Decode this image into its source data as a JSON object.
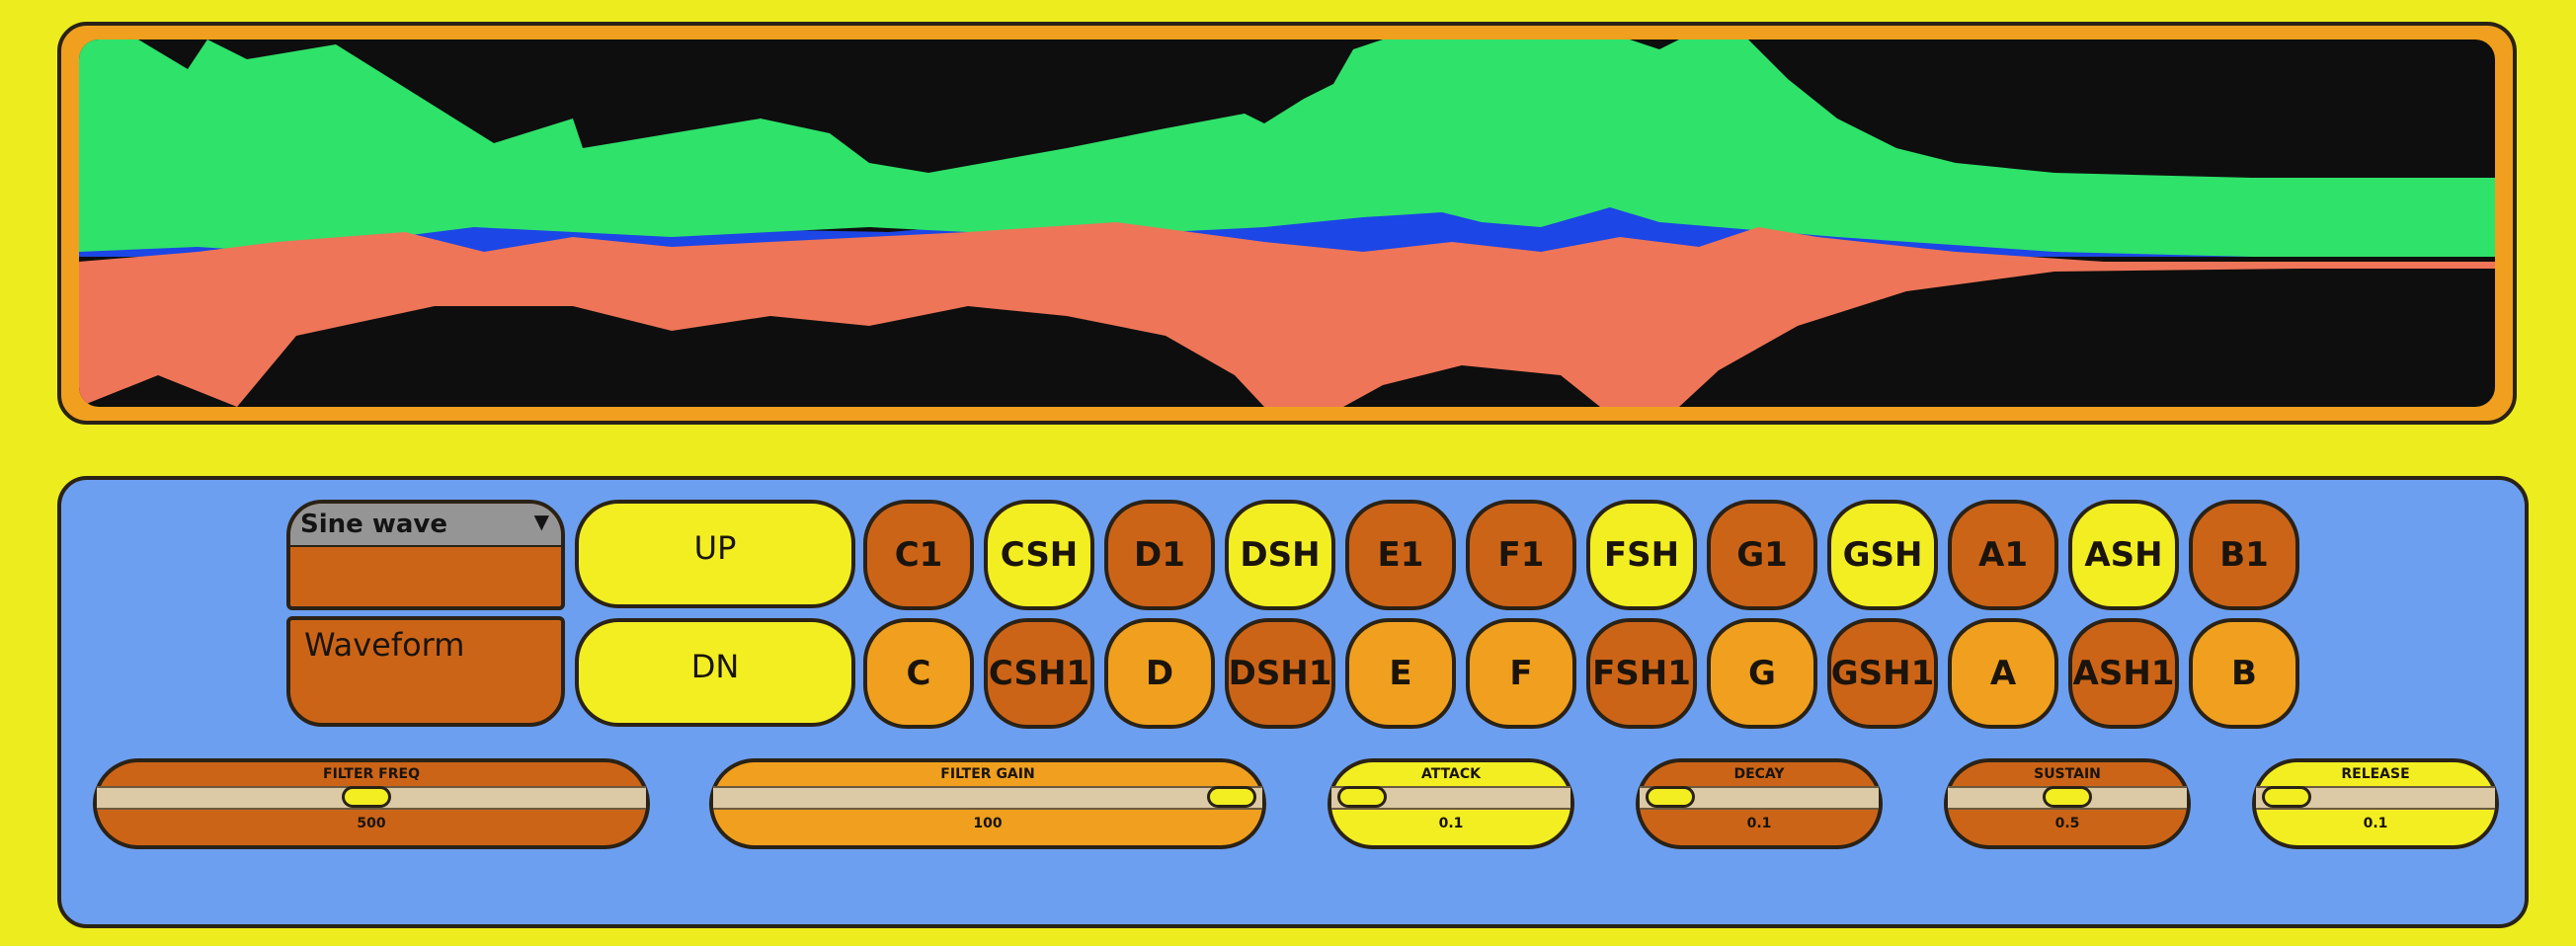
{
  "oscilloscope": {
    "colors": {
      "frame": "#f0a01e",
      "screen": "#0e0e0e",
      "green": "#2fe26a",
      "blue": "#1c46e6",
      "salmon": "#ee7558"
    }
  },
  "controls": {
    "waveform_select": {
      "selected": "Sine wave",
      "caret": "▼"
    },
    "waveform_label": "Waveform",
    "octave_up": "UP",
    "octave_down": "DN",
    "top_keys": [
      "C1",
      "CSH",
      "D1",
      "DSH",
      "E1",
      "F1",
      "FSH",
      "G1",
      "GSH",
      "A1",
      "ASH",
      "B1"
    ],
    "bottom_keys": [
      "C",
      "CSH1",
      "D",
      "DSH1",
      "E",
      "F",
      "FSH1",
      "G",
      "GSH1",
      "A",
      "ASH1",
      "B"
    ],
    "sliders": {
      "filter_freq": {
        "label": "FILTER FREQ",
        "value": "500",
        "level": 0.49
      },
      "filter_gain": {
        "label": "FILTER GAIN",
        "value": "100",
        "level": 1.0
      },
      "attack": {
        "label": "ATTACK",
        "value": "0.1",
        "level": 0.0
      },
      "decay": {
        "label": "DECAY",
        "value": "0.1",
        "level": 0.0
      },
      "sustain": {
        "label": "SUSTAIN",
        "value": "0.5",
        "level": 0.5
      },
      "release": {
        "label": "RELEASE",
        "value": "0.1",
        "level": 0.0
      }
    }
  },
  "colors": {
    "background": "#ecec1e",
    "panel": "#6d9ff0",
    "key_dark": "#cc6418",
    "key_light": "#f2ee22",
    "key_amber": "#f0a01e"
  }
}
